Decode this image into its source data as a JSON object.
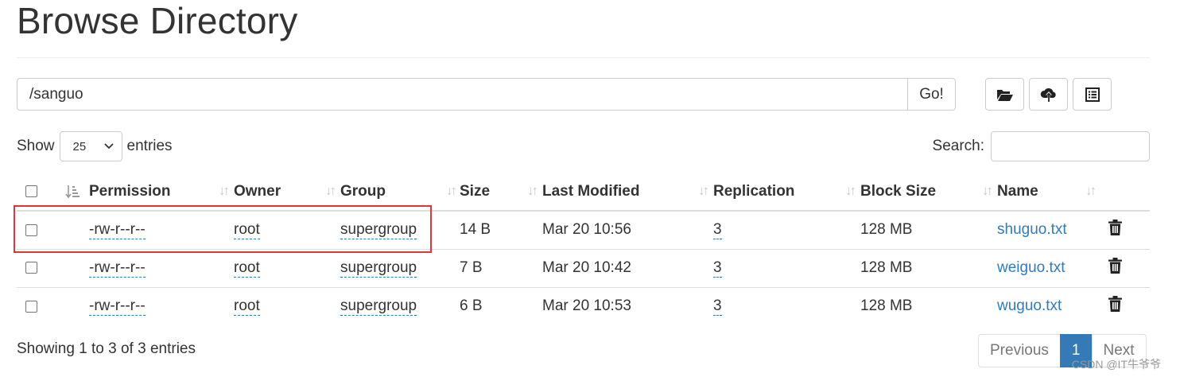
{
  "page": {
    "title": "Browse Directory"
  },
  "path_bar": {
    "value": "/sanguo",
    "go_label": "Go!"
  },
  "toolbar": {
    "buttons": [
      "folder-open-icon",
      "cloud-upload-icon",
      "list-icon"
    ]
  },
  "length_control": {
    "show_label": "Show",
    "selected": "25",
    "entries_label": "entries"
  },
  "search": {
    "label": "Search:",
    "value": ""
  },
  "table": {
    "columns": [
      "Permission",
      "Owner",
      "Group",
      "Size",
      "Last Modified",
      "Replication",
      "Block Size",
      "Name"
    ],
    "rows": [
      {
        "permission": "-rw-r--r--",
        "owner": "root",
        "group": "supergroup",
        "size": "14 B",
        "modified": "Mar 20 10:56",
        "replication": "3",
        "block_size": "128 MB",
        "name": "shuguo.txt"
      },
      {
        "permission": "-rw-r--r--",
        "owner": "root",
        "group": "supergroup",
        "size": "7 B",
        "modified": "Mar 20 10:42",
        "replication": "3",
        "block_size": "128 MB",
        "name": "weiguo.txt"
      },
      {
        "permission": "-rw-r--r--",
        "owner": "root",
        "group": "supergroup",
        "size": "6 B",
        "modified": "Mar 20 10:53",
        "replication": "3",
        "block_size": "128 MB",
        "name": "wuguo.txt"
      }
    ]
  },
  "footer": {
    "info": "Showing 1 to 3 of 3 entries"
  },
  "pagination": {
    "previous": "Previous",
    "current": "1",
    "next": "Next"
  },
  "watermark": "CSDN @IT牛爷爷",
  "colors": {
    "accent": "#337ab7",
    "highlight": "#e0353b"
  }
}
